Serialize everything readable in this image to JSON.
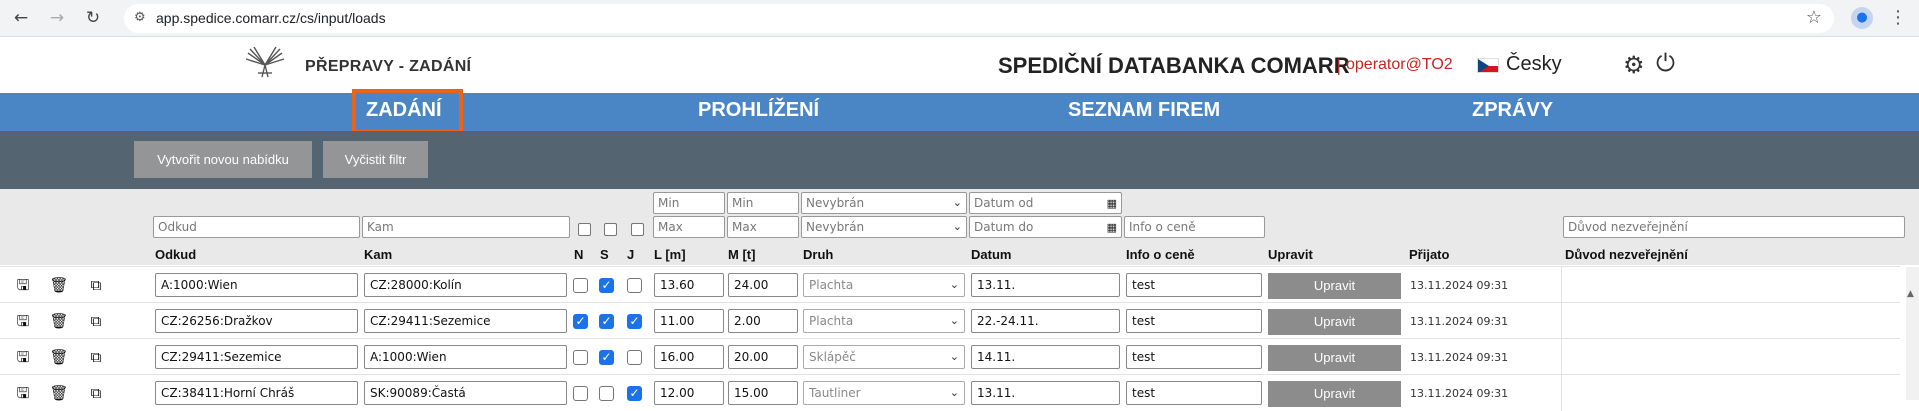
{
  "browser": {
    "url": "app.spedice.comarr.cz/cs/input/loads",
    "back_icon": "arrow-left-icon",
    "forward_icon": "arrow-right-icon",
    "reload_icon": "reload-icon"
  },
  "header": {
    "app_title": "PŘEPRAVY - ZADÁNÍ",
    "brand": "SPEDIČNÍ DATABANKA COMARR",
    "separator": "|",
    "user": "operator@TO2",
    "language": "Česky"
  },
  "nav": {
    "tabs": [
      {
        "label": "ZADÁNÍ",
        "active": true
      },
      {
        "label": "PROHLÍŽENÍ"
      },
      {
        "label": "SEZNAM FIREM"
      },
      {
        "label": "ZPRÁVY"
      }
    ]
  },
  "toolbar": {
    "new_offer": "Vytvořit novou nabídku",
    "clear_filter": "Vyčistit filtr"
  },
  "filters": {
    "from_placeholder": "Odkud",
    "to_placeholder": "Kam",
    "l_min": "Min",
    "l_max": "Max",
    "m_min": "Min",
    "m_max": "Max",
    "kind_top": "Nevybrán",
    "kind_bottom": "Nevybrán",
    "date_from": "Datum od",
    "date_to": "Datum do",
    "price_info": "Info o ceně",
    "reason": "Důvod nezveřejnění"
  },
  "columns": {
    "from": "Odkud",
    "to": "Kam",
    "n": "N",
    "s": "S",
    "j": "J",
    "l": "L [m]",
    "m": "M [t]",
    "kind": "Druh",
    "date": "Datum",
    "price": "Info o ceně",
    "edit": "Upravit",
    "received": "Přijato",
    "reason": "Důvod nezveřejnění"
  },
  "rows": [
    {
      "from": "A:1000:Wien",
      "to": "CZ:28000:Kolín",
      "n": false,
      "s": true,
      "j": false,
      "l": "13.60",
      "m": "24.00",
      "kind": "Plachta",
      "date": "13.11.",
      "price": "test",
      "edit": "Upravit",
      "received": "13.11.2024 09:31"
    },
    {
      "from": "CZ:26256:Dražkov",
      "to": "CZ:29411:Sezemice",
      "n": true,
      "s": true,
      "j": true,
      "l": "11.00",
      "m": "2.00",
      "kind": "Plachta",
      "date": "22.-24.11.",
      "price": "test",
      "edit": "Upravit",
      "received": "13.11.2024 09:31"
    },
    {
      "from": "CZ:29411:Sezemice",
      "to": "A:1000:Wien",
      "n": false,
      "s": true,
      "j": false,
      "l": "16.00",
      "m": "20.00",
      "kind": "Sklápěč",
      "date": "14.11.",
      "price": "test",
      "edit": "Upravit",
      "received": "13.11.2024 09:31"
    },
    {
      "from": "CZ:38411:Horní Chráš",
      "to": "SK:90089:Častá",
      "n": false,
      "s": false,
      "j": true,
      "l": "12.00",
      "m": "15.00",
      "kind": "Tautliner",
      "date": "13.11.",
      "price": "test",
      "edit": "Upravit",
      "received": "13.11.2024 09:31"
    }
  ],
  "colors": {
    "nav_blue": "#4a86c5",
    "toolbar": "#546471",
    "active_tab_outline": "#e8631c",
    "user_red": "#cc2222"
  }
}
